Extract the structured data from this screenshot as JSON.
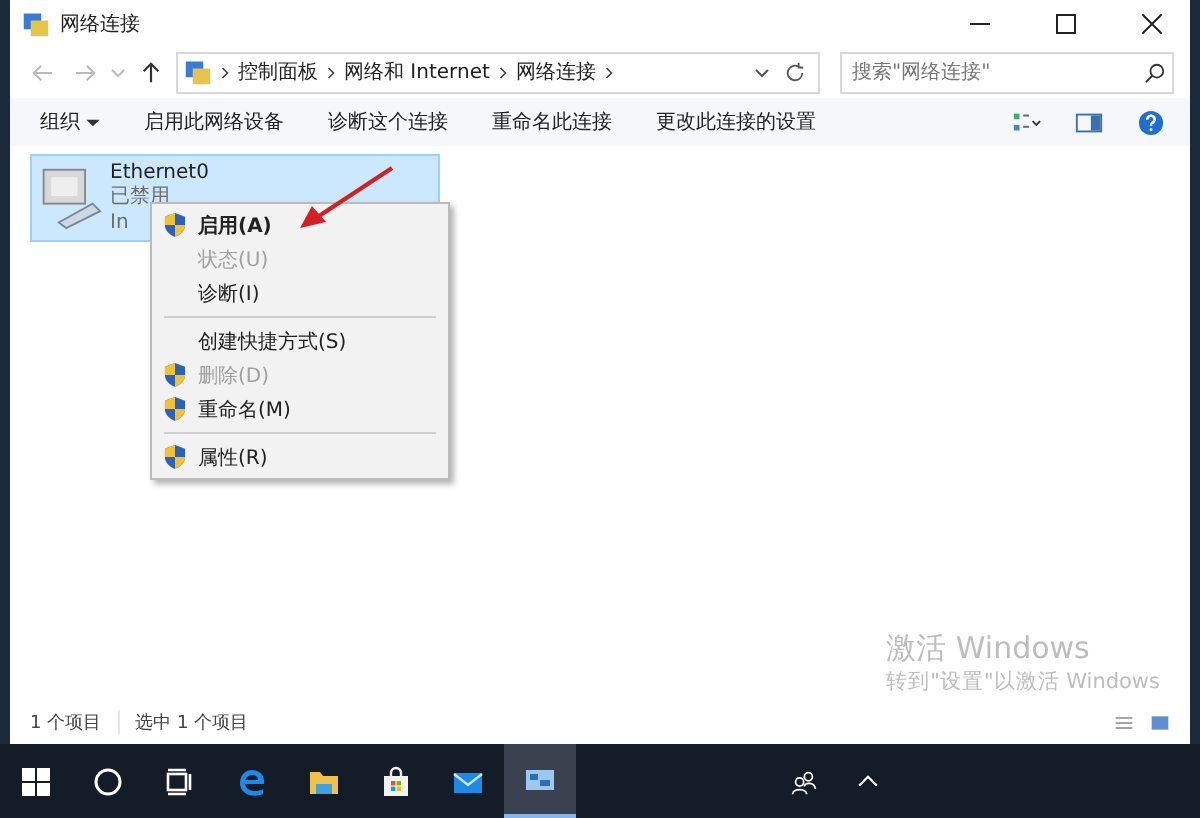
{
  "window": {
    "title": "网络连接"
  },
  "address_bar": {
    "path": [
      "控制面板",
      "网络和 Internet",
      "网络连接"
    ]
  },
  "search": {
    "placeholder": "搜索\"网络连接\""
  },
  "toolbar": {
    "organize": "组织",
    "commands": [
      "启用此网络设备",
      "诊断这个连接",
      "重命名此连接",
      "更改此连接的设置"
    ]
  },
  "connection": {
    "name": "Ethernet0",
    "status": "已禁用",
    "device": "In",
    "selected": true
  },
  "context_menu": {
    "items": [
      {
        "kind": "item",
        "label": "启用(A)",
        "shield": true,
        "default": true,
        "disabled": false
      },
      {
        "kind": "item",
        "label": "状态(U)",
        "shield": false,
        "default": false,
        "disabled": true
      },
      {
        "kind": "item",
        "label": "诊断(I)",
        "shield": false,
        "default": false,
        "disabled": false
      },
      {
        "kind": "separator"
      },
      {
        "kind": "item",
        "label": "创建快捷方式(S)",
        "shield": false,
        "default": false,
        "disabled": false
      },
      {
        "kind": "item",
        "label": "删除(D)",
        "shield": true,
        "default": false,
        "disabled": true
      },
      {
        "kind": "item",
        "label": "重命名(M)",
        "shield": true,
        "default": false,
        "disabled": false
      },
      {
        "kind": "separator"
      },
      {
        "kind": "item",
        "label": "属性(R)",
        "shield": true,
        "default": false,
        "disabled": false
      }
    ]
  },
  "activation_notice": {
    "title": "激活 Windows",
    "subtitle": "转到\"设置\"以激活 Windows"
  },
  "status_bar": {
    "item_count": "1 个项目",
    "selected_count": "选中 1 个项目"
  },
  "taskbar": {
    "apps": [
      {
        "kind": "start",
        "selected": false
      },
      {
        "kind": "search",
        "selected": false
      },
      {
        "kind": "taskview",
        "selected": false
      },
      {
        "kind": "browser",
        "selected": false
      },
      {
        "kind": "folder",
        "selected": false
      },
      {
        "kind": "store",
        "selected": false
      },
      {
        "kind": "mail",
        "selected": false
      },
      {
        "kind": "network",
        "selected": true
      }
    ]
  }
}
